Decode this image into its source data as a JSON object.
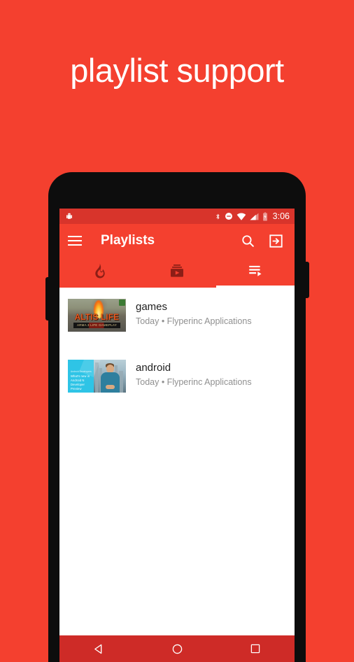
{
  "promo": {
    "headline": "playlist support",
    "background_color": "#F4402F"
  },
  "device": {
    "bezel_color": "#0D0D0D"
  },
  "status_bar": {
    "background_color": "#D8342B",
    "time": "3:06",
    "icons": [
      "android-robot-icon",
      "bluetooth-icon",
      "do-not-disturb-icon",
      "wifi-icon",
      "cellular-signal-icon",
      "battery-charging-icon"
    ]
  },
  "app_bar": {
    "title": "Playlists",
    "background_color": "#F4402F",
    "menu_label": "Menu",
    "search_label": "Search",
    "signin_label": "Sign in"
  },
  "tabs": {
    "active_index": 2,
    "items": [
      {
        "name": "trending",
        "icon": "flame-icon",
        "active": false
      },
      {
        "name": "subscriptions",
        "icon": "subscriptions-icon",
        "active": false
      },
      {
        "name": "playlists",
        "icon": "playlist-icon",
        "active": true
      }
    ]
  },
  "playlists": [
    {
      "title": "games",
      "subtitle": "Today • Flyperinc Applications",
      "thumbnail": {
        "name": "altis-life-thumbnail",
        "title_text": "ALTIS LIFE",
        "subtitle_text": "ARMA 3 LIFE GAMEPLAY"
      }
    },
    {
      "title": "android",
      "subtitle": "Today • Flyperinc Applications",
      "thumbnail": {
        "name": "android-n-preview-thumbnail",
        "channel_text": "Android Developers",
        "caption_text": "What's new in Android N Developer Preview"
      }
    }
  ],
  "nav_bar": {
    "background_color": "#CE2B27",
    "buttons": [
      {
        "name": "back",
        "label": "Back"
      },
      {
        "name": "home",
        "label": "Home"
      },
      {
        "name": "recents",
        "label": "Recents"
      }
    ]
  }
}
